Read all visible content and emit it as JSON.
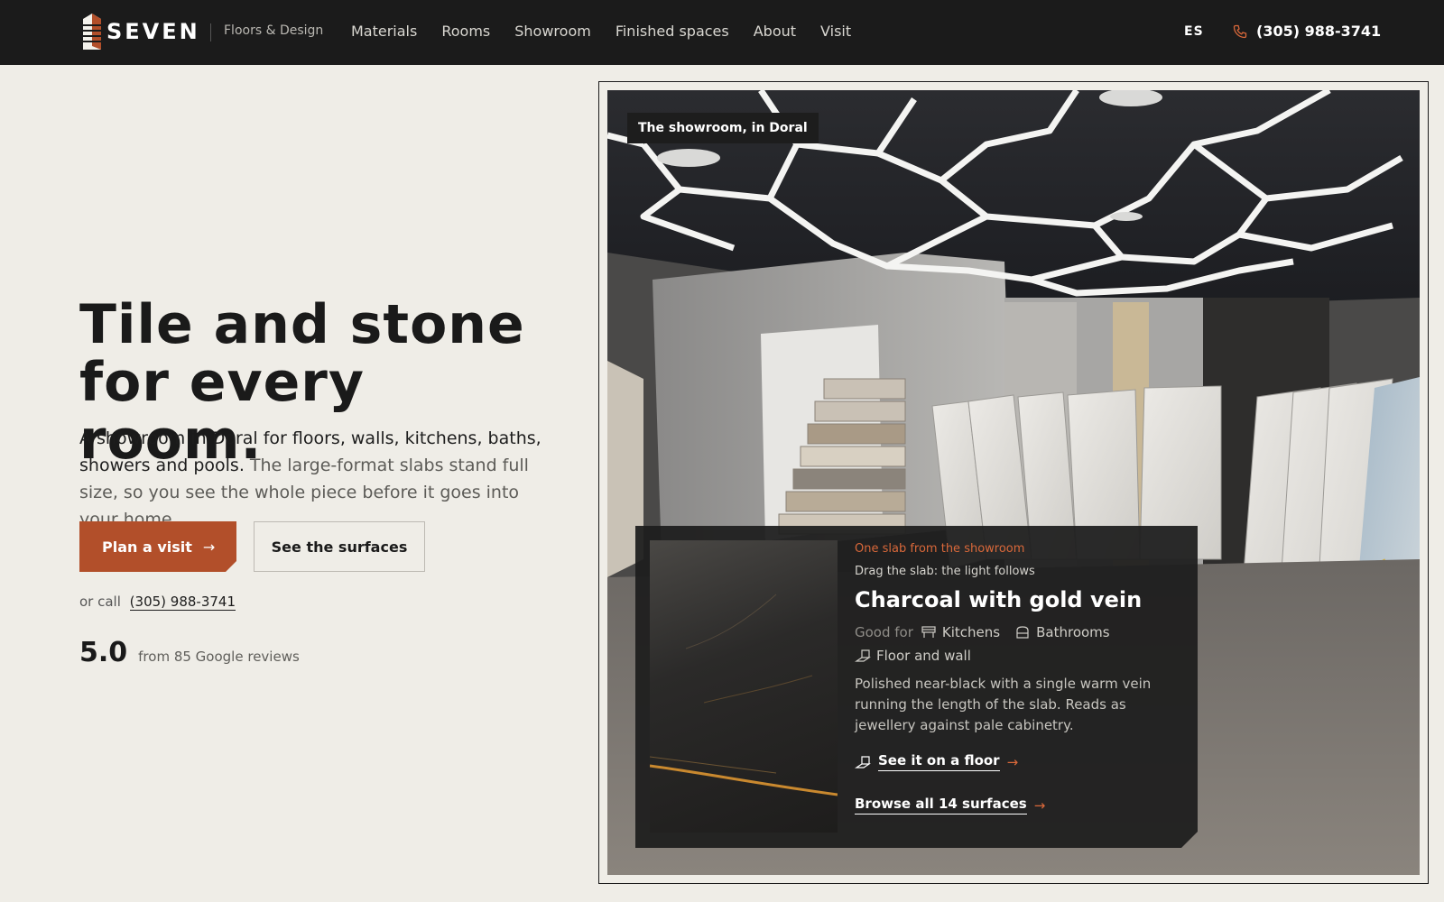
{
  "nav": {
    "brand": "SEVEN",
    "tagline": "Floors & Design",
    "menu": [
      "Materials",
      "Rooms",
      "Showroom",
      "Finished spaces",
      "About",
      "Visit"
    ],
    "lang": "ES",
    "phone": "(305) 988-3741"
  },
  "hero": {
    "headline_line1": "Tile and stone",
    "headline_line2": "for every room.",
    "lede_strong": "A showroom in Doral for floors, walls, kitchens, baths, showers and pools.",
    "lede_rest": " The large-format slabs stand full size, so you see the whole piece before it goes into your home.",
    "primary_cta": "Plan a visit",
    "secondary_cta": "See the surfaces",
    "call_prefix": "or call",
    "call_number": "(305) 988-3741",
    "rating": "5.0",
    "rating_text": "from 85 Google reviews"
  },
  "photo": {
    "label": "The showroom, in Doral"
  },
  "card": {
    "eyebrow": "One slab from the showroom",
    "hint": "Drag the slab: the light follows",
    "title": "Charcoal with gold vein",
    "good_for_label": "Good for",
    "tags": [
      "Kitchens",
      "Bathrooms",
      "Floor and wall"
    ],
    "description": "Polished near-black with a single warm vein running the length of the slab. Reads as jewellery against pale cabinetry.",
    "link_floor": "See it on a floor",
    "link_browse": "Browse all 14 surfaces"
  },
  "colors": {
    "accent": "#b24f2a",
    "accent_text": "#d9683a",
    "nav_bg": "#1b1b1b",
    "page_bg": "#efede7"
  },
  "icons": [
    "phone-icon",
    "arrow-right-icon",
    "kitchen-icon",
    "bath-icon",
    "floor-icon"
  ]
}
